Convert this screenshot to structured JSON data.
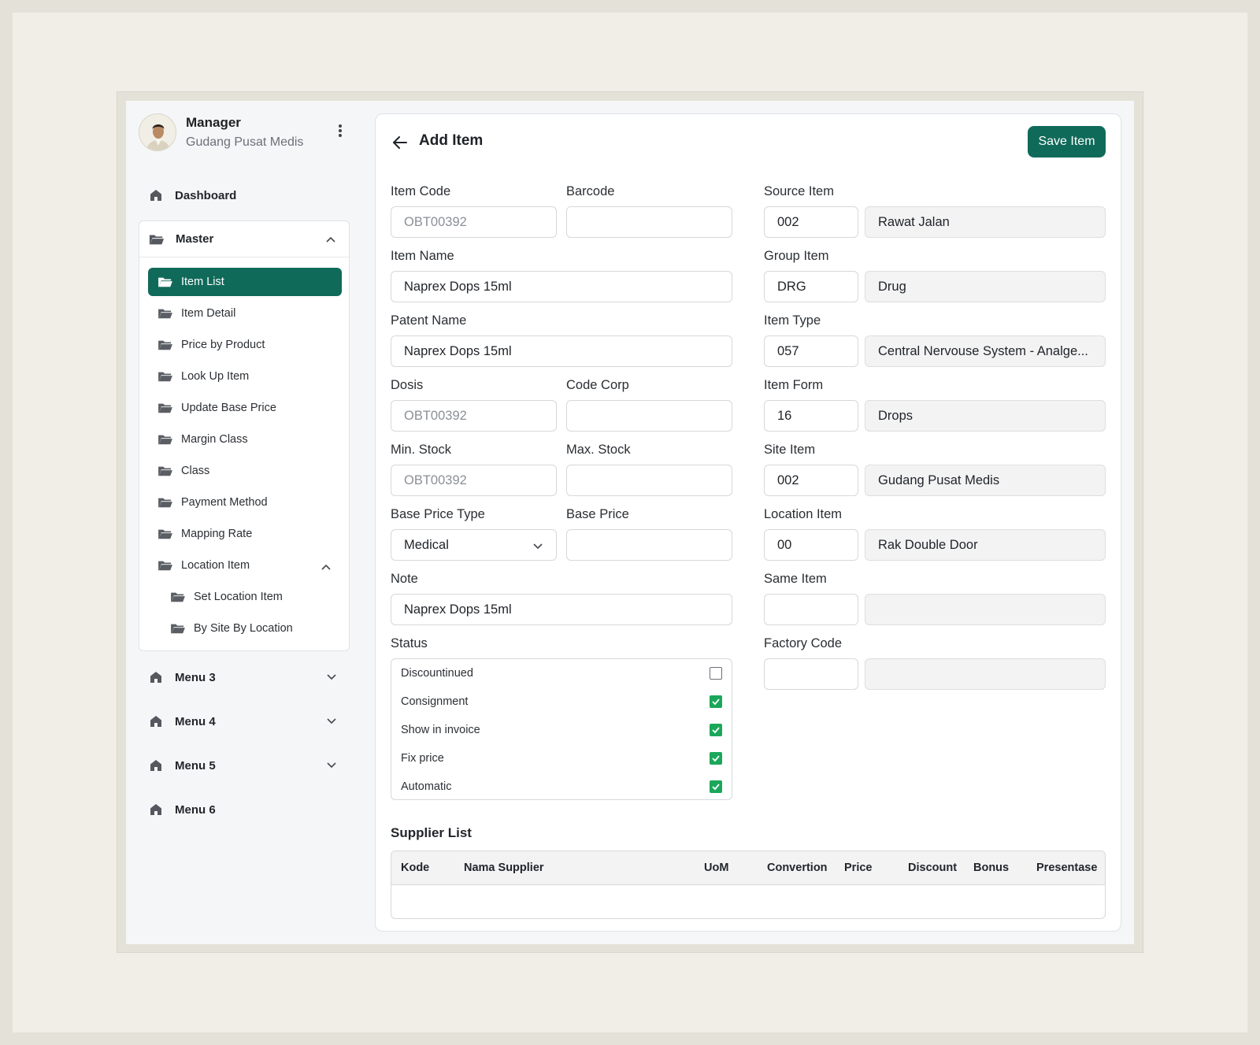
{
  "profile": {
    "name": "Manager",
    "role": "Gudang Pusat Medis"
  },
  "sidebar": {
    "dashboard": "Dashboard",
    "master": {
      "label": "Master",
      "items": [
        "Item List",
        "Item Detail",
        "Price by Product",
        "Look Up Item",
        "Update Base Price",
        "Margin Class",
        "Class",
        "Payment Method",
        "Mapping Rate",
        "Location Item"
      ],
      "location_children": [
        "Set Location Item",
        "By Site By Location"
      ]
    },
    "menus": [
      "Menu 3",
      "Menu 4",
      "Menu 5",
      "Menu 6"
    ]
  },
  "header": {
    "title": "Add Item",
    "save_label": "Save Item"
  },
  "form": {
    "item_code": {
      "label": "Item Code",
      "placeholder": "OBT00392",
      "value": ""
    },
    "barcode": {
      "label": "Barcode",
      "value": ""
    },
    "item_name": {
      "label": "Item Name",
      "value": "Naprex Dops 15ml"
    },
    "patent_name": {
      "label": "Patent Name",
      "value": "Naprex Dops 15ml"
    },
    "dosis": {
      "label": "Dosis",
      "placeholder": "OBT00392",
      "value": ""
    },
    "code_corp": {
      "label": "Code Corp",
      "value": ""
    },
    "min_stock": {
      "label": "Min. Stock",
      "placeholder": "OBT00392",
      "value": ""
    },
    "max_stock": {
      "label": "Max. Stock",
      "value": ""
    },
    "base_price_type": {
      "label": "Base Price Type",
      "value": "Medical"
    },
    "base_price": {
      "label": "Base Price",
      "value": ""
    },
    "note": {
      "label": "Note",
      "value": "Naprex Dops 15ml"
    },
    "status": {
      "label": "Status",
      "options": [
        {
          "label": "Discountinued",
          "checked": false
        },
        {
          "label": "Consignment",
          "checked": true
        },
        {
          "label": "Show in invoice",
          "checked": true
        },
        {
          "label": "Fix price",
          "checked": true
        },
        {
          "label": "Automatic",
          "checked": true
        }
      ]
    },
    "source_item": {
      "label": "Source Item",
      "code": "002",
      "name": "Rawat Jalan"
    },
    "group_item": {
      "label": "Group Item",
      "code": "DRG",
      "name": "Drug"
    },
    "item_type": {
      "label": "Item Type",
      "code": "057",
      "name": "Central Nervouse System - Analge..."
    },
    "item_form": {
      "label": "Item Form",
      "code": "16",
      "name": "Drops"
    },
    "site_item": {
      "label": "Site Item",
      "code": "002",
      "name": "Gudang Pusat Medis"
    },
    "location_item": {
      "label": "Location Item",
      "code": "00",
      "name": "Rak Double Door"
    },
    "same_item": {
      "label": "Same Item",
      "code": "",
      "name": ""
    },
    "factory_code": {
      "label": "Factory Code",
      "code": "",
      "name": ""
    }
  },
  "supplier": {
    "title": "Supplier List",
    "columns": [
      "Kode",
      "Nama Supplier",
      "UoM",
      "Convertion",
      "Price",
      "Discount",
      "Bonus",
      "Presentase"
    ]
  },
  "colors": {
    "primary": "#106a5a",
    "check": "#1ba75a",
    "background": "#f0eee7"
  }
}
